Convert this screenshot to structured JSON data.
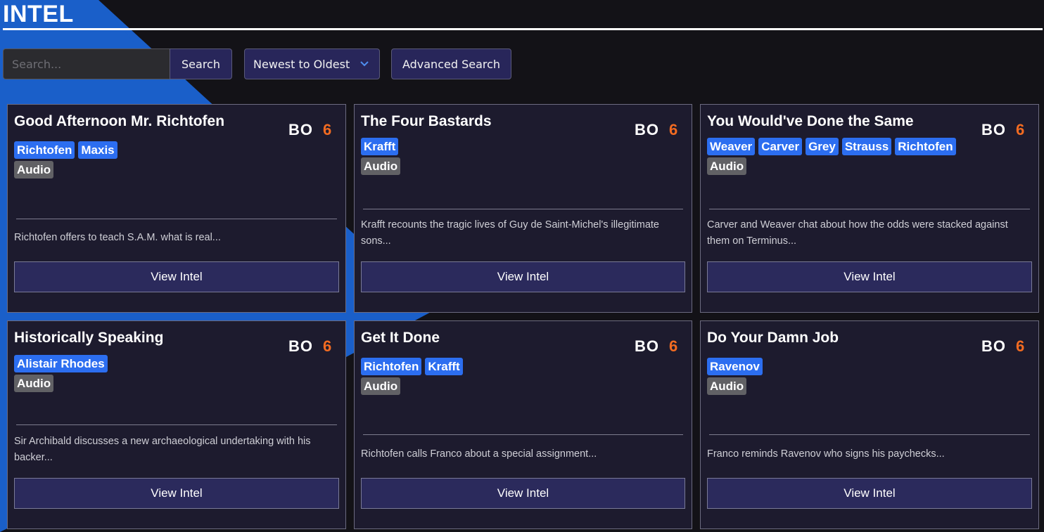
{
  "header": {
    "title": "INTEL"
  },
  "toolbar": {
    "search_placeholder": "Search...",
    "search_label": "Search",
    "sort_label": "Newest to Oldest",
    "advanced_label": "Advanced Search"
  },
  "colors": {
    "background": "#131217",
    "accent_blue": "#1a5fc9",
    "card_bg": "#1d1b2e",
    "button_bg": "#2b2a5c",
    "tag_character": "#2c6ef0",
    "tag_type": "#616165",
    "logo_orange": "#f26b21"
  },
  "logo_text": {
    "left": "BO",
    "right": "6"
  },
  "cards": [
    {
      "title": "Good Afternoon Mr. Richtofen",
      "characters": [
        "Richtofen",
        "Maxis"
      ],
      "type": "Audio",
      "description": "Richtofen offers to teach S.A.M. what is real...",
      "button": "View Intel"
    },
    {
      "title": "The Four Bastards",
      "characters": [
        "Krafft"
      ],
      "type": "Audio",
      "description": "Krafft recounts the tragic lives of Guy de Saint-Michel's illegitimate sons...",
      "button": "View Intel"
    },
    {
      "title": "You Would've Done the Same",
      "characters": [
        "Weaver",
        "Carver",
        "Grey",
        "Strauss",
        "Richtofen"
      ],
      "type": "Audio",
      "description": "Carver and Weaver chat about how the odds were stacked against them on Terminus...",
      "button": "View Intel"
    },
    {
      "title": "Historically Speaking",
      "characters": [
        "Alistair Rhodes"
      ],
      "type": "Audio",
      "description": "Sir Archibald discusses a new archaeological undertaking with his backer...",
      "button": "View Intel"
    },
    {
      "title": "Get It Done",
      "characters": [
        "Richtofen",
        "Krafft"
      ],
      "type": "Audio",
      "description": "Richtofen calls Franco about a special assignment...",
      "button": "View Intel"
    },
    {
      "title": "Do Your Damn Job",
      "characters": [
        "Ravenov"
      ],
      "type": "Audio",
      "description": "Franco reminds Ravenov who signs his paychecks...",
      "button": "View Intel"
    }
  ]
}
